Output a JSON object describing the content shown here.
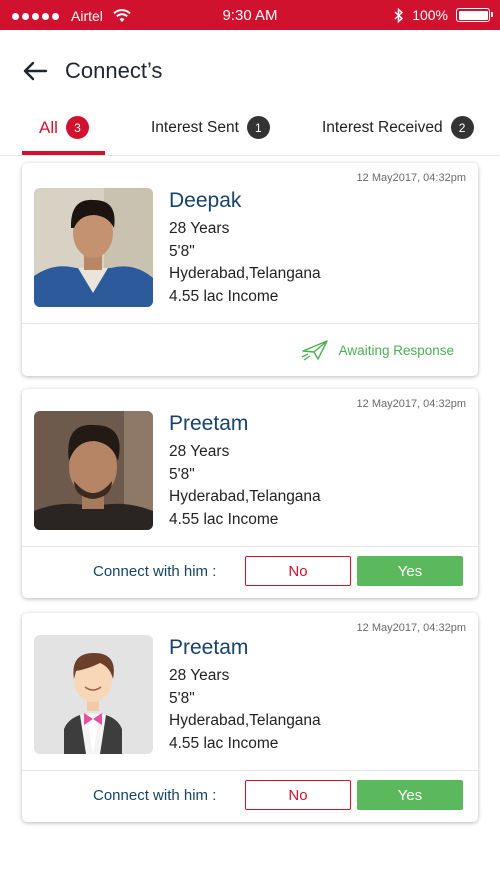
{
  "status_bar": {
    "carrier": "Airtel",
    "time": "9:30 AM",
    "battery": "100%",
    "battery_level": 1.0
  },
  "header": {
    "title": "Connect’s",
    "back_icon": "back-arrow-icon"
  },
  "tabs": [
    {
      "label": "All",
      "count": "3",
      "active": true
    },
    {
      "label": "Interest Sent",
      "count": "1",
      "active": false
    },
    {
      "label": "Interest Received",
      "count": "2",
      "active": false
    }
  ],
  "cards": [
    {
      "date": "12 May2017, 04:32pm",
      "name": "Deepak",
      "age": "28 Years",
      "height": "5'8\"",
      "location": "Hyderabad,Telangana",
      "income": "4.55 lac Income",
      "status": "Awaiting Response"
    },
    {
      "date": "12 May2017, 04:32pm",
      "name": "Preetam",
      "age": "28 Years",
      "height": "5'8\"",
      "location": "Hyderabad,Telangana",
      "income": "4.55 lac Income",
      "connect_label": "Connect with him :",
      "no_label": "No",
      "yes_label": "Yes"
    },
    {
      "date": "12 May2017, 04:32pm",
      "name": "Preetam",
      "age": "28 Years",
      "height": "5'8\"",
      "location": "Hyderabad,Telangana",
      "income": "4.55 lac Income",
      "connect_label": "Connect with him :",
      "no_label": "No",
      "yes_label": "Yes"
    }
  ],
  "colors": {
    "brand": "#d0122f",
    "name": "#17426b",
    "yes": "#5cb85c",
    "awaiting": "#4caf50"
  }
}
